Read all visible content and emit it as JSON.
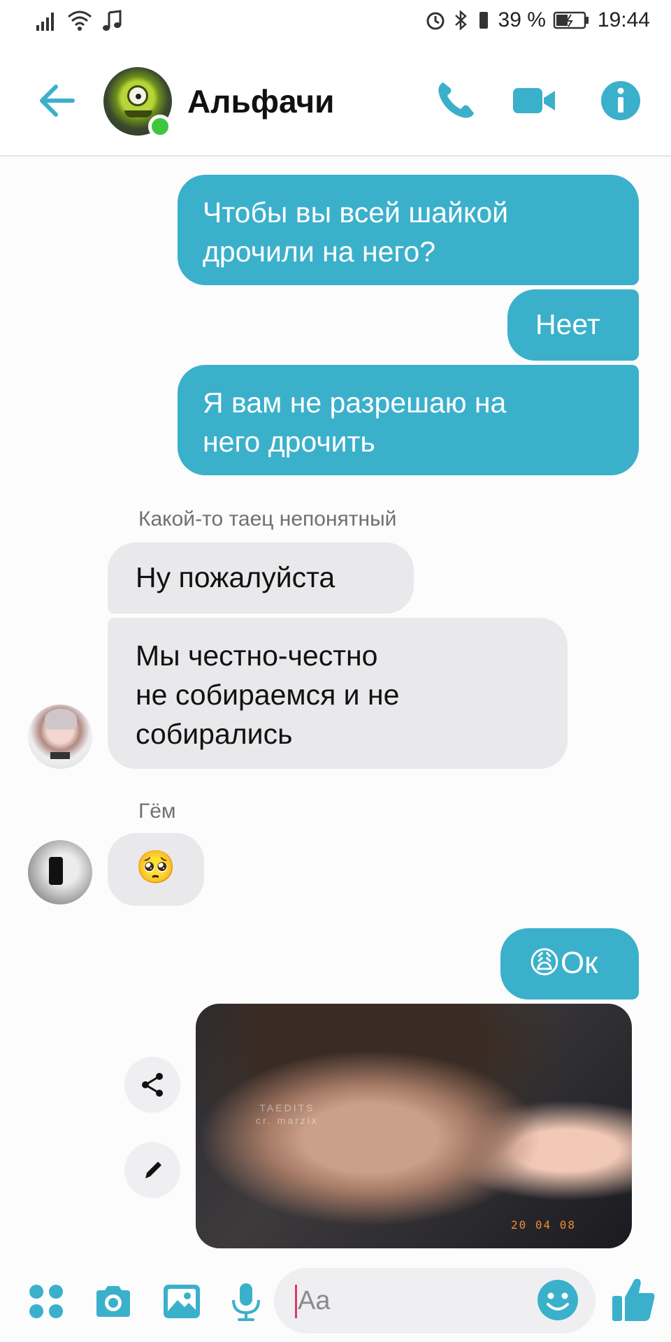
{
  "status_bar": {
    "battery_percent": "39 %",
    "time": "19:44"
  },
  "header": {
    "back_icon": "arrow-left-icon",
    "chat_title": "Альфачи",
    "online": true,
    "actions": [
      "phone-icon",
      "video-call-icon",
      "info-icon"
    ]
  },
  "colors": {
    "accent": "#3bb0cb",
    "incoming_bubble": "#e9e9ec",
    "online": "#3ec73e"
  },
  "messages": {
    "m1_line1": "Чтобы вы всей шайкой",
    "m1_line2": "дрочили на него?",
    "m2": "Неет",
    "m3_line1": "Я вам не разрешаю на",
    "m3_line2": "него дрочить",
    "sender1": "Какой-то таец непонятный",
    "m4": "Ну пожалуйста",
    "m5_line1": "Мы честно-честно",
    "m5_line2": "не собираемся и не",
    "m5_line3": "собирались",
    "sender2": "Гём",
    "m6_emoji": "🥺",
    "m7_emoji": "😩",
    "m7_text": "Ок"
  },
  "photo": {
    "watermark_line1": "TAEDITS",
    "watermark_line2": "cr. marzix",
    "date_stamp": "20 04 08"
  },
  "composer": {
    "placeholder": "Aa",
    "icons": [
      "apps-icon",
      "camera-icon",
      "gallery-icon",
      "microphone-icon",
      "emoji-icon",
      "thumbs-up-icon"
    ]
  }
}
